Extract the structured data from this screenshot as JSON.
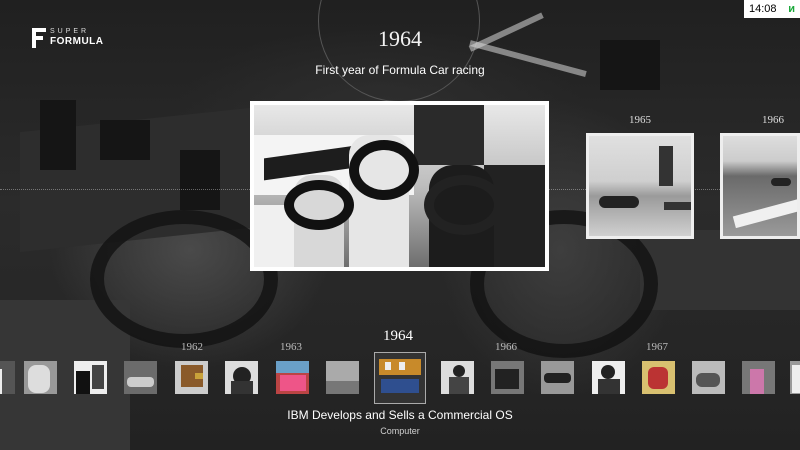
{
  "header": {
    "logo_super": "SUPER",
    "logo_formula": "FORMULA",
    "clock": "14:08",
    "status_icon": "n-network-icon"
  },
  "featured": {
    "year": "1964",
    "description": "First year of Formula Car racing"
  },
  "side_items": [
    {
      "year": "1965"
    },
    {
      "year": "1966"
    }
  ],
  "timeline": {
    "years": [
      "1962",
      "1963",
      "1964",
      "1966",
      "1967"
    ],
    "selected_year": "1964",
    "selected_title": "IBM Develops and Sells a Commercial OS",
    "selected_category": "Computer"
  },
  "colors": {
    "accent": "#1aa83a",
    "background": "#1a1a1a"
  }
}
